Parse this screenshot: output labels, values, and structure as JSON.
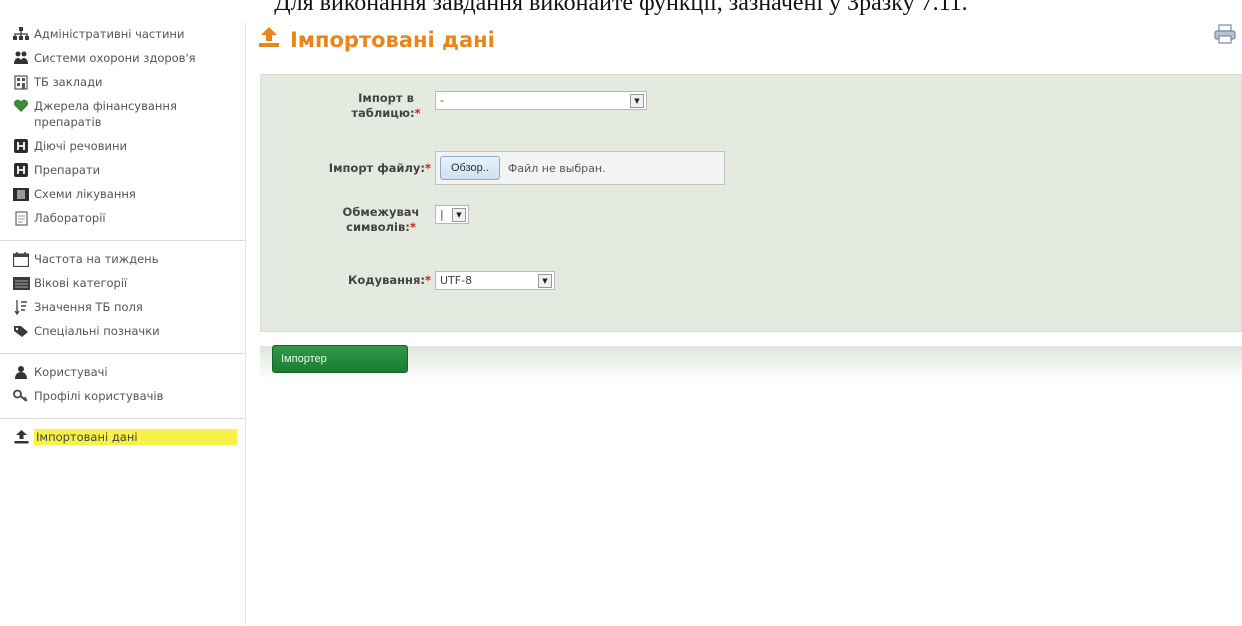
{
  "caption": "Для виконання завдання виконайте функції, зазначені у Зразку 7.11.",
  "sidebar": {
    "groups": [
      {
        "items": [
          {
            "label": "Адміністративні частини",
            "icon": "org-chart-icon"
          },
          {
            "label": "Системи охорони здоров'я",
            "icon": "people-group-icon"
          },
          {
            "label": "ТБ заклади",
            "icon": "building-icon"
          },
          {
            "label": "Джерела фінансування препаратів",
            "icon": "heart-handshake-icon"
          },
          {
            "label": "Діючі речовини",
            "icon": "h-square-icon"
          },
          {
            "label": "Препарати",
            "icon": "h-square-icon"
          },
          {
            "label": "Схеми лікування",
            "icon": "film-icon"
          },
          {
            "label": "Лабораторії",
            "icon": "document-icon"
          }
        ]
      },
      {
        "items": [
          {
            "label": "Частота на тиждень",
            "icon": "calendar-icon"
          },
          {
            "label": "Вікові категорії",
            "icon": "bar-table-icon"
          },
          {
            "label": "Значення ТБ поля",
            "icon": "sort-list-icon"
          },
          {
            "label": "Спеціальні позначки",
            "icon": "tags-icon"
          }
        ]
      },
      {
        "items": [
          {
            "label": "Користувачі",
            "icon": "user-icon"
          },
          {
            "label": "Профілі користувачів",
            "icon": "key-icon"
          }
        ]
      },
      {
        "items": [
          {
            "label": "Імпортовані дані",
            "icon": "upload-icon",
            "active": true
          }
        ]
      }
    ]
  },
  "header": {
    "title": "Імпортовані дані"
  },
  "form": {
    "import_table": {
      "label": "Імпорт в таблицю:",
      "value": "-"
    },
    "import_file": {
      "label": "Імпорт файлу:",
      "button": "Обзор..",
      "status": "Файл не выбран."
    },
    "delimiter": {
      "label": "Обмежувач символів:",
      "value": "|"
    },
    "encoding": {
      "label": "Кодування:",
      "value": "UTF-8"
    },
    "required_mark": "*"
  },
  "actions": {
    "import_label": "Імпортер"
  },
  "colors": {
    "accent_orange": "#e8861a",
    "panel_green": "#e4eae0",
    "button_green": "#1d7a33",
    "highlight_yellow": "#f6f24a",
    "required_red": "#d21a1a"
  }
}
